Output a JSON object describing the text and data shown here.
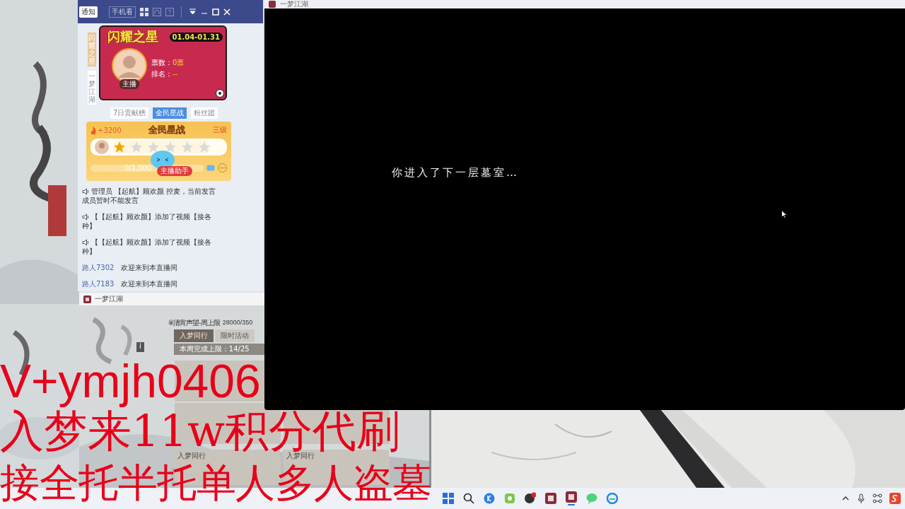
{
  "live_panel": {
    "toolbar": {
      "notice_button": "通知",
      "mobile_button": "手机看"
    },
    "side_tabs": [
      {
        "label": "闪耀之星",
        "selected": true
      },
      {
        "label": "一梦江湖",
        "selected": false
      }
    ],
    "banner": {
      "title": "闪耀之星",
      "dates": "01.04-01.31",
      "votes_label": "票数：",
      "votes": "0票",
      "rank_label": "排名：",
      "rank": "--",
      "host_tag": "主播"
    },
    "tabs": [
      {
        "label": "7日贡献榜",
        "selected": false
      },
      {
        "label": "全民星战",
        "selected": true
      },
      {
        "label": "粉丝团",
        "selected": false
      }
    ],
    "star_war": {
      "heat": "+3200",
      "title": "全民星战",
      "grade": "三级",
      "stars": 1,
      "progress": "0/1,000",
      "level": 0,
      "assistant_badge": "主播助手"
    },
    "chat": [
      {
        "kind": "system",
        "text": "管理员 【起航】顾欢颜 控麦，当前发言成员暂时不能发言"
      },
      {
        "kind": "system",
        "text": "【【起航】顾欢颜】添加了视频【接各种】"
      },
      {
        "kind": "system",
        "text": "【【起航】顾欢颜】添加了视频【接各种】"
      },
      {
        "kind": "user",
        "user": "路人7302",
        "text": "欢迎来到本直播间"
      },
      {
        "kind": "user",
        "user": "路人7183",
        "text": "欢迎来到本直播间"
      }
    ]
  },
  "game_window": {
    "title": "一梦江湖",
    "reputation": "※清宵声望-周上限",
    "reputation_value": "28000/350",
    "tabs": [
      {
        "label": "入梦同行",
        "selected": true
      },
      {
        "label": "限时活动",
        "selected": false
      }
    ],
    "info_label": "i",
    "weekly_limit": "本周完成上限：14/25",
    "cards": [
      {
        "title": "入梦同行"
      },
      {
        "title": "入梦同行"
      }
    ]
  },
  "main_window": {
    "title": "一梦江湖",
    "caption": "你进入了下一层墓室…"
  },
  "overlay": [
    "V+ymjh0406",
    "入梦来11w积分代刷",
    "接全托半托单人多人盗墓"
  ]
}
